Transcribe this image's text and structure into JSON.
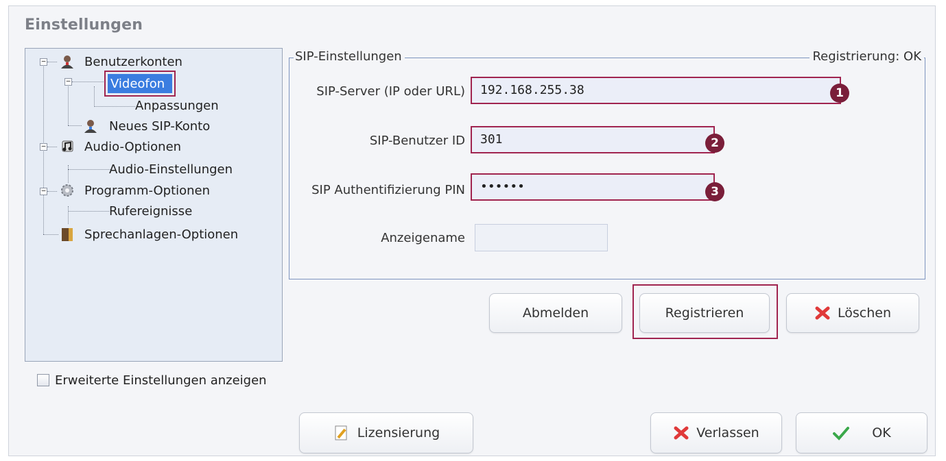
{
  "window": {
    "title": "Einstellungen"
  },
  "tree": {
    "items": [
      {
        "label": "Benutzerkonten",
        "icon": "user-accounts-icon"
      },
      {
        "label": "Videofon",
        "selected": true
      },
      {
        "label": "Anpassungen"
      },
      {
        "label": "Neues SIP-Konto",
        "icon": "new-user-icon"
      },
      {
        "label": "Audio-Optionen",
        "icon": "music-note-icon"
      },
      {
        "label": "Audio-Einstellungen"
      },
      {
        "label": "Programm-Optionen",
        "icon": "gears-icon"
      },
      {
        "label": "Rufereignisse"
      },
      {
        "label": "Sprechanlagen-Optionen",
        "icon": "door-icon"
      }
    ]
  },
  "sip": {
    "group_title": "SIP-Einstellungen",
    "status": "Registrierung: OK",
    "server": {
      "label": "SIP-Server (IP oder URL)",
      "value": "192.168.255.38",
      "marker": "1"
    },
    "user_id": {
      "label": "SIP-Benutzer ID",
      "value": "301",
      "marker": "2"
    },
    "pin": {
      "label": "SIP Authentifizierung PIN",
      "value": "••••••",
      "marker": "3"
    },
    "display_name": {
      "label": "Anzeigename",
      "value": ""
    }
  },
  "buttons": {
    "logout": "Abmelden",
    "register": "Registrieren",
    "delete": "Löschen",
    "license": "Lizensierung",
    "exit": "Verlassen",
    "ok": "OK"
  },
  "advanced": {
    "label": "Erweiterte Einstellungen anzeigen",
    "checked": false
  },
  "colors": {
    "highlight": "#a0244f",
    "selection": "#3a7de0",
    "marker": "#7a1e3a"
  }
}
